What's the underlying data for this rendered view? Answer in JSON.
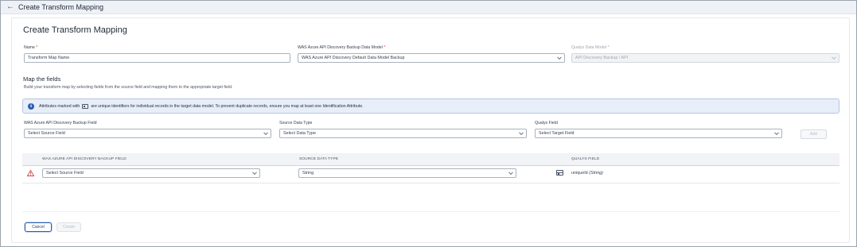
{
  "header": {
    "back_icon": "arrow-left-icon",
    "title": "Create Transform Mapping"
  },
  "main": {
    "title": "Create Transform Mapping",
    "name_field": {
      "label": "Name",
      "required_mark": "*",
      "placeholder": "Transform Map Name"
    },
    "source_model": {
      "label": "WAS Azure API Discovery Backup Data Model",
      "required_mark": "*",
      "value": "WAS Azure API Discovery Default Data Model Backup"
    },
    "qualys_model": {
      "label": "Qualys Data Model",
      "required_mark": "*",
      "value": "API Discovery Backup / API",
      "disabled": true
    }
  },
  "mapping": {
    "title": "Map the fields",
    "subtitle": "Build your transform map by selecting fields from the source field and mapping them to the appropriate target field.",
    "info": {
      "icon": "info-icon",
      "text_before": "Attributes marked with",
      "id_icon": "identification-attribute-icon",
      "text_after": "are unique identifiers for individual records in the target data model. To prevent duplicate records, ensure you map at least one Identification Attribute."
    },
    "source_field": {
      "label": "WAS Azure API Discovery Backup Field",
      "placeholder": "Select Source Field"
    },
    "source_type": {
      "label": "Source Data Type",
      "placeholder": "Select Data Type"
    },
    "qualys_field": {
      "label": "Qualys Field",
      "placeholder": "Select Target Field"
    },
    "add_button": "Add"
  },
  "table": {
    "columns": [
      "WAS AZURE API DISCOVERY BACKUP FIELD",
      "SOURCE DATA TYPE",
      "QUALYS FIELD"
    ],
    "rows": [
      {
        "status_icon": "warning-icon",
        "source_field": "Select Source Field",
        "data_type": "String",
        "qualys_field_icon": "identification-attribute-icon",
        "qualys_field_name": "uniqueId",
        "qualys_field_type": "(String)"
      }
    ]
  },
  "footer": {
    "cancel": "Cancel",
    "create": "Create"
  },
  "colors": {
    "accent": "#2a5db0",
    "info_bg": "#e8eef8",
    "warning": "#d0312d",
    "required": "#d0312d"
  }
}
